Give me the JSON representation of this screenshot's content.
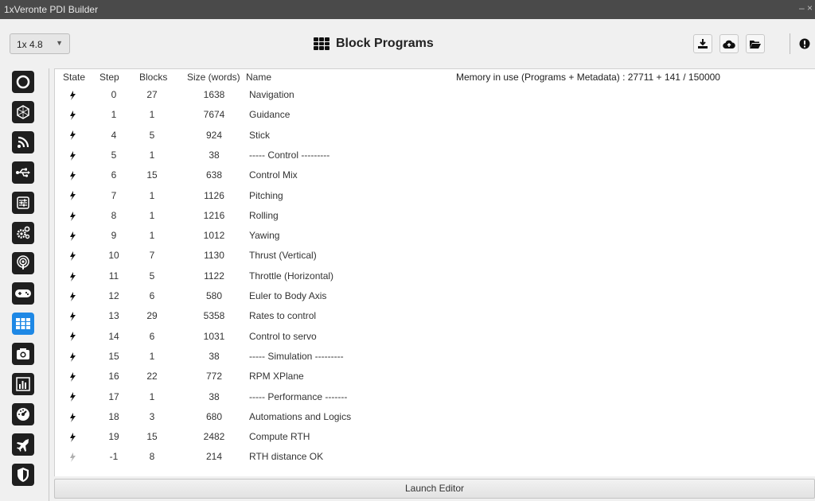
{
  "window": {
    "title": "1xVeronte PDI Builder"
  },
  "toolbar": {
    "version_selected": "1x 4.8",
    "page_title": "Block Programs",
    "buttons": [
      "download-icon",
      "cloud-upload-icon",
      "folder-open-icon",
      "info-icon"
    ]
  },
  "sidebar": {
    "items": [
      {
        "icon": "connection-icon",
        "active": false
      },
      {
        "icon": "hexagon-icon",
        "active": false
      },
      {
        "icon": "signal-icon",
        "active": false
      },
      {
        "icon": "usb-icon",
        "active": false
      },
      {
        "icon": "sliders-icon",
        "active": false
      },
      {
        "icon": "gears-icon",
        "active": false
      },
      {
        "icon": "podcast-icon",
        "active": false
      },
      {
        "icon": "gamepad-icon",
        "active": false
      },
      {
        "icon": "block-programs-icon",
        "active": true
      },
      {
        "icon": "camera-icon",
        "active": false
      },
      {
        "icon": "bar-chart-icon",
        "active": false
      },
      {
        "icon": "dashboard-icon",
        "active": false
      },
      {
        "icon": "plane-icon",
        "active": false
      },
      {
        "icon": "shield-icon",
        "active": false
      }
    ]
  },
  "table": {
    "headers": {
      "state": "State",
      "step": "Step",
      "blocks": "Blocks",
      "size": "Size (words)",
      "name": "Name"
    },
    "memory_label": "Memory in use (Programs + Metadata) : 27711 + 141 / 150000",
    "rows": [
      {
        "state": "active",
        "step": "0",
        "blocks": "27",
        "size": "1638",
        "name": "Navigation"
      },
      {
        "state": "active",
        "step": "1",
        "blocks": "1",
        "size": "7674",
        "name": "Guidance"
      },
      {
        "state": "active",
        "step": "4",
        "blocks": "5",
        "size": "924",
        "name": "Stick"
      },
      {
        "state": "active",
        "step": "5",
        "blocks": "1",
        "size": "38",
        "name": "----- Control ---------"
      },
      {
        "state": "active",
        "step": "6",
        "blocks": "15",
        "size": "638",
        "name": "Control Mix"
      },
      {
        "state": "active",
        "step": "7",
        "blocks": "1",
        "size": "1126",
        "name": "Pitching"
      },
      {
        "state": "active",
        "step": "8",
        "blocks": "1",
        "size": "1216",
        "name": "Rolling"
      },
      {
        "state": "active",
        "step": "9",
        "blocks": "1",
        "size": "1012",
        "name": "Yawing"
      },
      {
        "state": "active",
        "step": "10",
        "blocks": "7",
        "size": "1130",
        "name": "Thrust (Vertical)"
      },
      {
        "state": "active",
        "step": "11",
        "blocks": "5",
        "size": "1122",
        "name": "Throttle (Horizontal)"
      },
      {
        "state": "active",
        "step": "12",
        "blocks": "6",
        "size": "580",
        "name": "Euler to Body Axis"
      },
      {
        "state": "active",
        "step": "13",
        "blocks": "29",
        "size": "5358",
        "name": "Rates to control"
      },
      {
        "state": "active",
        "step": "14",
        "blocks": "6",
        "size": "1031",
        "name": "Control to servo"
      },
      {
        "state": "active",
        "step": "15",
        "blocks": "1",
        "size": "38",
        "name": "----- Simulation ---------"
      },
      {
        "state": "active",
        "step": "16",
        "blocks": "22",
        "size": "772",
        "name": "RPM XPlane"
      },
      {
        "state": "active",
        "step": "17",
        "blocks": "1",
        "size": "38",
        "name": "----- Performance -------"
      },
      {
        "state": "active",
        "step": "18",
        "blocks": "3",
        "size": "680",
        "name": "Automations and Logics"
      },
      {
        "state": "active",
        "step": "19",
        "blocks": "15",
        "size": "2482",
        "name": "Compute RTH"
      },
      {
        "state": "inactive",
        "step": "-1",
        "blocks": "8",
        "size": "214",
        "name": "RTH distance OK"
      }
    ]
  },
  "footer": {
    "launch_label": "Launch Editor"
  },
  "colors": {
    "accent": "#1e88e5",
    "icon_bg": "#1f1f1f",
    "titlebar": "#4a4a4a",
    "bolt_active": "#111111",
    "bolt_inactive": "#b0b0b0"
  }
}
